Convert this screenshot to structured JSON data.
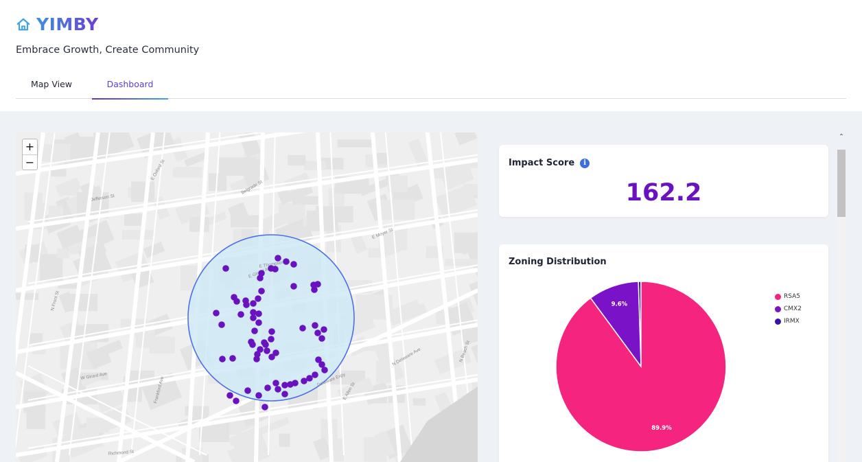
{
  "app": {
    "name": "YIMBY",
    "tagline": "Embrace Growth, Create Community",
    "logo_icon": "house-icon"
  },
  "tabs": [
    {
      "label": "Map View",
      "active": false
    },
    {
      "label": "Dashboard",
      "active": true
    }
  ],
  "map": {
    "zoom_in": "+",
    "zoom_out": "−",
    "street_labels": [
      "E Girard Ave",
      "Delaware Expy",
      "N Delaware Ave",
      "E Thompson St",
      "Belgrade St",
      "Frankford Ave",
      "E Allen St",
      "E Moyer St",
      "W Girard Ave",
      "N Front St",
      "E Oxford St",
      "Jefferson St",
      "N Beach St",
      "Richmond St"
    ],
    "pin_color": "#6a12c0",
    "radius_fill": "#cfeaf7",
    "radius_stroke": "#4a6fe8"
  },
  "impact": {
    "title": "Impact Score",
    "info_icon": "info-icon",
    "value": "162.2"
  },
  "zoning": {
    "title": "Zoning Distribution",
    "legend": [
      {
        "label": "RSA5",
        "color": "#f5257f"
      },
      {
        "label": "CMX2",
        "color": "#7a12c8"
      },
      {
        "label": "IRMX",
        "color": "#3a12a8"
      }
    ]
  },
  "chart_data": {
    "type": "pie",
    "title": "Zoning Distribution",
    "categories": [
      "RSA5",
      "CMX2",
      "IRMX"
    ],
    "values": [
      89.9,
      9.6,
      0.5
    ],
    "labels": [
      "89.9%",
      "9.6%",
      ""
    ],
    "colors": [
      "#f5257f",
      "#7a12c8",
      "#3a12a8"
    ],
    "legend": "top-right"
  },
  "scrollbar": {
    "up_icon": "chevron-up-icon"
  }
}
